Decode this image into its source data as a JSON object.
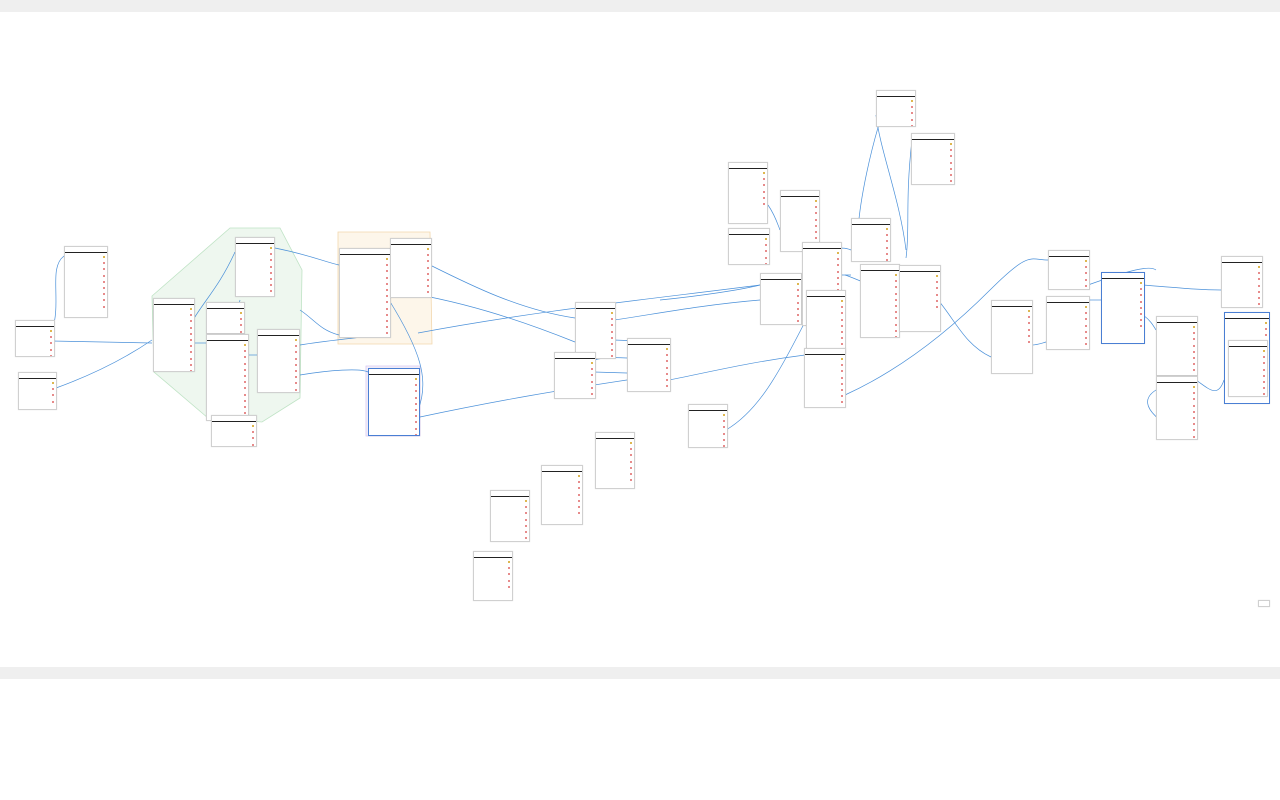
{
  "canvas": {
    "background": "#ffffff",
    "bar_color": "#efefef",
    "link_color": "#4a90d9",
    "field_marker_color": "#e06666"
  },
  "groups": [
    {
      "id": "grp-green",
      "label": "",
      "fill": "#eef7ef",
      "stroke": "#bfe3c5",
      "label_color": "#57a45f"
    },
    {
      "id": "grp-orange",
      "label": "",
      "fill": "#fdf6ea",
      "stroke": "#f2d7ad",
      "label_color": "#d89a3a"
    },
    {
      "id": "grp-purple",
      "label": "",
      "fill": "#f6f2fc",
      "stroke": "#d8c9f0",
      "label_color": "#8f6fc7"
    }
  ],
  "tables": [
    {
      "id": "t-a",
      "name": "",
      "fields": [
        "",
        "",
        "",
        "",
        ""
      ]
    },
    {
      "id": "t-b",
      "name": "",
      "fields": [
        "",
        "",
        "",
        ""
      ]
    },
    {
      "id": "t-c",
      "name": "",
      "fields": [
        "",
        "",
        "",
        "",
        "",
        "",
        "",
        "",
        ""
      ]
    },
    {
      "id": "t-d",
      "name": "",
      "fields": [
        "",
        "",
        "",
        "",
        "",
        "",
        "",
        "",
        "",
        "",
        ""
      ]
    },
    {
      "id": "t-e",
      "name": "",
      "fields": [
        "",
        "",
        "",
        ""
      ]
    },
    {
      "id": "t-f",
      "name": "",
      "fields": [
        "",
        "",
        "",
        "",
        "",
        "",
        "",
        ""
      ]
    },
    {
      "id": "t-g",
      "name": "",
      "fields": [
        "",
        "",
        "",
        "",
        "",
        "",
        "",
        "",
        "",
        "",
        "",
        "",
        "",
        "",
        ""
      ]
    },
    {
      "id": "t-h",
      "name": "",
      "fields": [
        "",
        "",
        "",
        ""
      ]
    },
    {
      "id": "t-i",
      "name": "",
      "fields": [
        "",
        "",
        "",
        "",
        "",
        "",
        "",
        "",
        ""
      ]
    },
    {
      "id": "t-j",
      "name": "",
      "fields": [
        "",
        "",
        "",
        "",
        "",
        "",
        "",
        "",
        "",
        "",
        "",
        "",
        "",
        ""
      ]
    },
    {
      "id": "t-k",
      "name": "",
      "fields": [
        "",
        "",
        "",
        "",
        "",
        "",
        "",
        "",
        ""
      ]
    },
    {
      "id": "t-l",
      "name": "",
      "fields": [
        "",
        "",
        "",
        "",
        "",
        "",
        "",
        "",
        "",
        "",
        ""
      ]
    },
    {
      "id": "t-m",
      "name": "",
      "fields": [
        "",
        "",
        "",
        "",
        "",
        "",
        "",
        "",
        ""
      ]
    },
    {
      "id": "t-n",
      "name": "",
      "fields": [
        "",
        "",
        "",
        "",
        "",
        "",
        ""
      ]
    },
    {
      "id": "t-o",
      "name": "",
      "fields": [
        "",
        "",
        "",
        "",
        "",
        "",
        ""
      ]
    },
    {
      "id": "t-p",
      "name": "",
      "fields": [
        "",
        "",
        "",
        "",
        "",
        "",
        ""
      ]
    },
    {
      "id": "t-q",
      "name": "",
      "fields": [
        "",
        "",
        "",
        "",
        "",
        "",
        ""
      ]
    },
    {
      "id": "t-r",
      "name": "",
      "fields": [
        "",
        "",
        "",
        "",
        "",
        "",
        ""
      ]
    },
    {
      "id": "t-s",
      "name": "",
      "fields": [
        "",
        "",
        "",
        "",
        ""
      ]
    },
    {
      "id": "t-t",
      "name": "",
      "fields": [
        "",
        "",
        "",
        "",
        "",
        "",
        "",
        ""
      ]
    },
    {
      "id": "t-u",
      "name": "",
      "fields": [
        "",
        "",
        "",
        "",
        "",
        ""
      ]
    },
    {
      "id": "t-v",
      "name": "",
      "fields": [
        "",
        "",
        "",
        "",
        "",
        "",
        "",
        "",
        ""
      ]
    },
    {
      "id": "t-w",
      "name": "",
      "fields": [
        "",
        "",
        "",
        "",
        "",
        "",
        "",
        "",
        ""
      ]
    },
    {
      "id": "t-x",
      "name": "",
      "fields": [
        "",
        "",
        "",
        "",
        "",
        "",
        "",
        "",
        "",
        "",
        ""
      ]
    },
    {
      "id": "t-y",
      "name": "",
      "fields": [
        "",
        "",
        "",
        "",
        "",
        "",
        "",
        "",
        "",
        "",
        "",
        ""
      ]
    },
    {
      "id": "t-z",
      "name": "",
      "fields": [
        "",
        "",
        "",
        "",
        "",
        "",
        "",
        "",
        "",
        ""
      ]
    },
    {
      "id": "t-aa",
      "name": "",
      "fields": [
        "",
        "",
        "",
        "",
        "",
        "",
        "",
        "",
        ""
      ]
    },
    {
      "id": "t-ab",
      "name": "",
      "fields": [
        "",
        "",
        "",
        "",
        "",
        "",
        ""
      ]
    },
    {
      "id": "t-ac",
      "name": "",
      "fields": [
        "",
        "",
        "",
        "",
        "",
        "",
        "",
        "",
        "",
        "",
        ""
      ]
    },
    {
      "id": "t-ad",
      "name": "",
      "fields": [
        "",
        "",
        "",
        "",
        "",
        "",
        "",
        "",
        "",
        ""
      ]
    },
    {
      "id": "t-ae",
      "name": "",
      "fields": [
        "",
        "",
        "",
        "",
        "",
        "",
        "",
        "",
        "",
        "",
        "",
        "",
        ""
      ]
    },
    {
      "id": "t-af",
      "name": "",
      "fields": [
        "",
        "",
        "",
        "",
        "",
        ""
      ]
    },
    {
      "id": "t-ag",
      "name": "",
      "fields": [
        "",
        "",
        "",
        "",
        "",
        ""
      ]
    },
    {
      "id": "t-ah",
      "name": "",
      "fields": [
        "",
        "",
        "",
        "",
        ""
      ]
    },
    {
      "id": "t-ai",
      "name": "",
      "fields": [
        "",
        "",
        "",
        "",
        "",
        "",
        "",
        "",
        "",
        "",
        "",
        ""
      ]
    },
    {
      "id": "t-aj",
      "name": "",
      "fields": [
        "",
        "",
        "",
        "",
        "",
        "",
        "",
        ""
      ]
    },
    {
      "id": "t-ak",
      "name": "",
      "fields": [
        "",
        "",
        "",
        "",
        "",
        "",
        "",
        "",
        "",
        "",
        "",
        "",
        "",
        ""
      ]
    },
    {
      "id": "t-al",
      "name": "",
      "fields": [
        "",
        "",
        "",
        "",
        "",
        "",
        "",
        "",
        "",
        "",
        "",
        "",
        "",
        ""
      ]
    },
    {
      "id": "t-am",
      "name": "",
      "fields": [
        "",
        "",
        "",
        "",
        "",
        "",
        "",
        "",
        "",
        "",
        ""
      ]
    },
    {
      "id": "t-an",
      "name": "",
      "fields": [
        "",
        "",
        "",
        "",
        "",
        "",
        "",
        "",
        ""
      ]
    },
    {
      "id": "t-ao",
      "name": "",
      "fields": [
        "",
        "",
        "",
        "",
        "",
        "",
        "",
        ""
      ]
    },
    {
      "id": "t-ap",
      "name": "",
      "fields": [
        "",
        "",
        "",
        "",
        "",
        "",
        "",
        "",
        ""
      ]
    }
  ]
}
